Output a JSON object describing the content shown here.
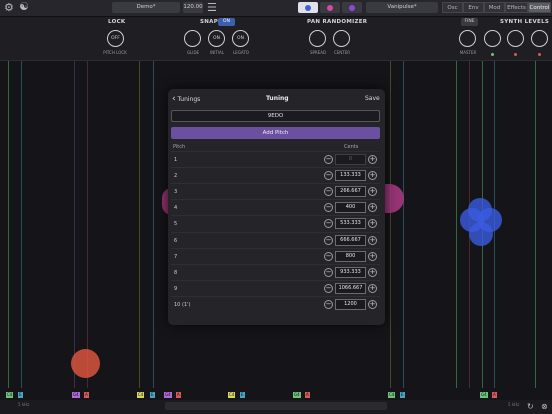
{
  "topbar": {
    "preset": "Demo*",
    "tempo": "120.00",
    "patch": "Vanipulse*",
    "tabs": [
      "Osc",
      "Env",
      "Mod",
      "Effects",
      "Control"
    ],
    "active_tab": "Control"
  },
  "lock": {
    "title": "LOCK",
    "button": "OFF",
    "label": "PITCH LOCK"
  },
  "snap": {
    "title": "SNAP",
    "toggle": "ON",
    "glide": "GLIDE",
    "initial_value": "ON",
    "initial_label": "INITIAL",
    "legato_value": "ON",
    "legato_label": "LEGATO"
  },
  "pan": {
    "title": "PAN RANDOMIZER",
    "spread": "SPREAD",
    "center": "CENTER"
  },
  "synth": {
    "title": "SYNTH LEVELS",
    "fine": "FINE",
    "master": "MASTER"
  },
  "tuning": {
    "back": "Tunings",
    "title": "Tuning",
    "save": "Save",
    "name": "9EDO",
    "add_pitch": "Add Pitch",
    "col_pitch": "Pitch",
    "col_cents": "Cents",
    "rows": [
      {
        "n": "1",
        "c": "0"
      },
      {
        "n": "2",
        "c": "133.333"
      },
      {
        "n": "3",
        "c": "266.667"
      },
      {
        "n": "4",
        "c": "400"
      },
      {
        "n": "5",
        "c": "533.333"
      },
      {
        "n": "6",
        "c": "666.667"
      },
      {
        "n": "7",
        "c": "800"
      },
      {
        "n": "8",
        "c": "933.333"
      },
      {
        "n": "9",
        "c": "1066.667"
      },
      {
        "n": "10 (1')",
        "c": "1200"
      }
    ]
  },
  "notes": [
    {
      "t": "C4",
      "c": "#6fc27a"
    },
    {
      "t": "E",
      "c": "#49a6c2"
    },
    {
      "t": "G4",
      "c": "#b06ad8"
    },
    {
      "t": "A",
      "c": "#d65a5a"
    },
    {
      "t": "C4",
      "c": "#d8d660"
    },
    {
      "t": "E",
      "c": "#49a6c2"
    },
    {
      "t": "G4",
      "c": "#b06ad8"
    },
    {
      "t": "A",
      "c": "#d65a5a"
    },
    {
      "t": "C4",
      "c": "#d8d660"
    },
    {
      "t": "E",
      "c": "#49a6c2"
    },
    {
      "t": "G4",
      "c": "#6fc27a"
    },
    {
      "t": "A",
      "c": "#d65a5a"
    },
    {
      "t": "C4",
      "c": "#6fc27a"
    },
    {
      "t": "E",
      "c": "#49a6c2"
    },
    {
      "t": "G4",
      "c": "#6fc27a"
    },
    {
      "t": "A",
      "c": "#d65a5a"
    }
  ],
  "bottom": {
    "left": "5 kHz",
    "right": "5 kHz"
  }
}
